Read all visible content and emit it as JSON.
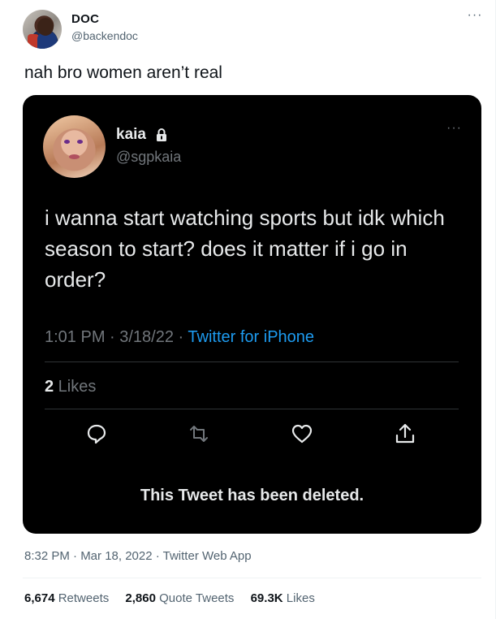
{
  "author": {
    "display_name": "DOC",
    "handle": "@backendoc",
    "more_icon": "more-horizontal-icon"
  },
  "tweet": {
    "text": "nah bro women aren’t real"
  },
  "quoted": {
    "display_name": "kaia",
    "handle": "@sgpkaia",
    "protected_icon": "lock-icon",
    "text": "i wanna start watching sports but idk which season to start? does it matter if i go in order?",
    "time": "1:01 PM · 3/18/22 · ",
    "source": "Twitter for iPhone",
    "likes_count": "2",
    "likes_label": " Likes",
    "actions": [
      "reply-icon",
      "retweet-icon",
      "like-icon",
      "share-icon"
    ],
    "deleted_notice": "This Tweet has been deleted."
  },
  "meta": {
    "timestamp": "8:32 PM · Mar 18, 2022 · Twitter Web App"
  },
  "stats": {
    "retweets_count": "6,674",
    "retweets_label": "Retweets",
    "quote_count": "2,860",
    "quote_label": "Quote Tweets",
    "likes_count": "69.3K",
    "likes_label": "Likes"
  },
  "colors": {
    "accent": "#1d9bf0",
    "text": "#0f1419",
    "muted": "#536471",
    "embed_bg": "#000000"
  }
}
